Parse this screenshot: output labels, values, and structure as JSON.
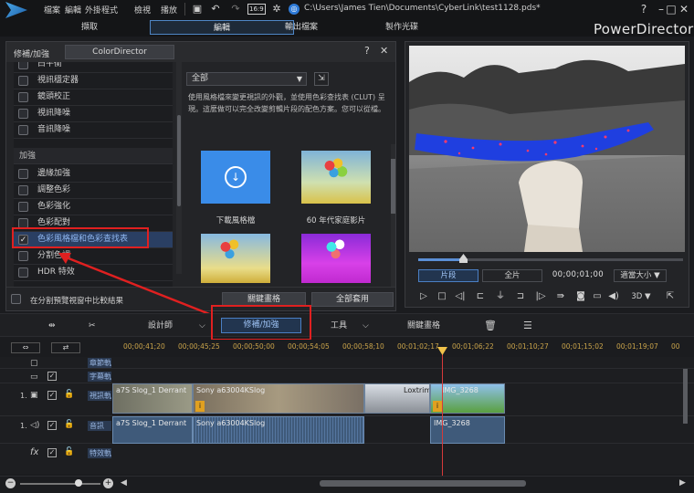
{
  "topbar": {
    "menu": [
      "檔案",
      "編輯",
      "外掛程式",
      "檢視",
      "播放"
    ],
    "aspect": "16:9",
    "file_path": "C:\\Users\\James Tien\\Documents\\CyberLink\\test1128.pds*",
    "win": {
      "help": "?",
      "minimize": "–",
      "maximize": "□",
      "close": "✕"
    }
  },
  "modes": {
    "capture": "擷取",
    "edit": "編輯",
    "output": "輸出檔案",
    "disc": "製作光碟"
  },
  "brand": "PowerDirector",
  "room": {
    "tab_fix": "修補/加強",
    "tab_colordirector": "ColorDirector",
    "help": "?",
    "close": "✕",
    "items_top": [
      "白平衡",
      "視訊穩定器",
      "鏡頭校正",
      "視訊降噪",
      "音訊降噪"
    ],
    "section_enhance": "加強",
    "items_enhance": [
      "邊緣加強",
      "調整色彩",
      "色彩強化",
      "色彩配對",
      "色彩風格檔和色彩查找表",
      "分割色調",
      "HDR 特效"
    ],
    "selected_checkmark": "✓",
    "filter_value": "全部",
    "filter_arrow": "▼",
    "import_icon": "⇲",
    "description": "使用風格檔來變更視訊的外觀，並使用色彩查找表 (CLUT) 呈現。這麼做可以完全改變剪輯片段的配色方案。您可以從檔。",
    "presets": [
      "下載風格檔",
      "60 年代家庭影片"
    ],
    "compare_label": "在分割預覽視窗中比較結果",
    "keyframe_btn": "關鍵畫格",
    "apply_all_btn": "全部套用"
  },
  "preview": {
    "clip_btn": "片段",
    "movie_btn": "全片",
    "timecode": "00;00;01;00",
    "fit_btn": "適當大小 ▼",
    "ctrl_3d": "3D ▼"
  },
  "toolbar": {
    "designer": "設計師",
    "fix_enhance": "修補/加強",
    "tools": "工具",
    "keyframe": "關鍵畫格"
  },
  "ruler_ticks": [
    "00;00;41;20",
    "00;00;45;25",
    "00;00;50;00",
    "00;00;54;05",
    "00;00;58;10",
    "00;01;02;17",
    "00;01;06;22",
    "00;01;10;27",
    "00;01;15;02",
    "00;01;19;07",
    "00"
  ],
  "tracks": {
    "chapter": "章節軌",
    "subtitle": "字幕軌",
    "video_num": "1.",
    "video": "視訊軌",
    "audio_num": "1.",
    "audio": "音訊",
    "fx": "fx",
    "effect": "特效軌"
  },
  "clips": {
    "v1": "a7S Slog_1 Derrant",
    "v2": "Sony a63004KSlog",
    "v3": "Loxtrim",
    "v4": "IMG_3268",
    "a1": "a7S Slog_1 Derrant",
    "a2": "Sony a63004KSlog",
    "a3": "IMG_3268"
  },
  "colors": {
    "accent": "#4f86c6",
    "callout": "#e02020",
    "playhead": "#d63a3a"
  }
}
